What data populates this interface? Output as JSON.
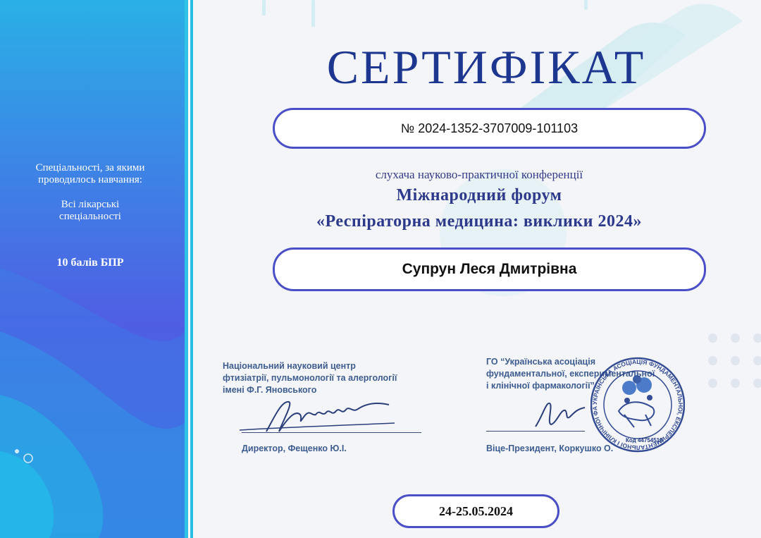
{
  "certificate": {
    "title": "СЕРТИФІКАТ",
    "number": "№ 2024-1352-3707009-101103",
    "subtitle": "слухача науково-практичної конференції",
    "forum_line1": "Міжнародний форум",
    "forum_line2": "«Респіраторна медицина: виклики 2024»",
    "participant": "Супрун Леся Дмитрівна",
    "date": "24-25.05.2024"
  },
  "sidebar": {
    "specialties_label_1": "Спеціальності, за якими",
    "specialties_label_2": "проводилось навчання:",
    "specialties_value_1": "Всі лікарські",
    "specialties_value_2": "спеціальності",
    "points": "10 балів БПР"
  },
  "signatories": {
    "left": {
      "org_line1": "Національний науковий центр",
      "org_line2": "фтизіатрії, пульмонології та алергології",
      "org_line3": "імені Ф.Г. Яновського",
      "role": "Директор, Фещенко Ю.І."
    },
    "right": {
      "org_line1": "ГО “Українська асоціація",
      "org_line2": "фундаментальної, експериментальної",
      "org_line3": "і клінічної фармакології”",
      "role": "Віце-Президент, Коркушко О.",
      "stamp_text": "УКРАЇНСЬКА АСОЦІАЦІЯ ФУНДАМЕНТАЛЬНОЇ, ЕКСПЕРИМЕНТАЛЬНОЇ І КЛІНІЧНОЇ ФАРМАКОЛОГІЇ · ВІНИЦЯ · ГРОМАДСЬКА ОРГАНІЗАЦІЯ",
      "stamp_code": "Код 44754519"
    }
  },
  "colors": {
    "title": "#1d3690",
    "pill_border": "#4a4fc8",
    "stamp": "#1f3a8a"
  }
}
